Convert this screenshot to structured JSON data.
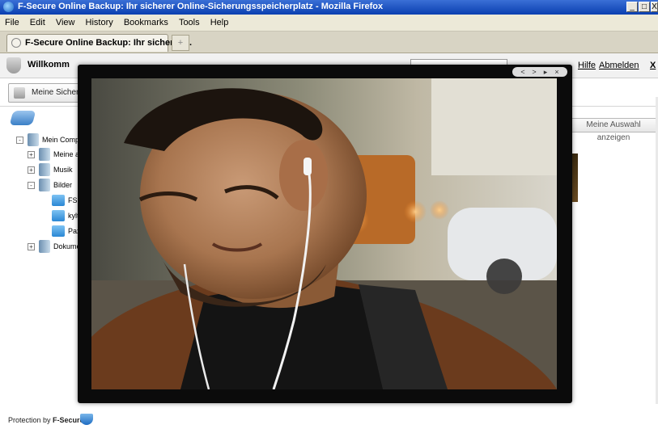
{
  "window": {
    "title": "F-Secure Online Backup: Ihr sicherer Online-Sicherungsspeicherplatz - Mozilla Firefox",
    "buttons": [
      "_",
      "□",
      "X"
    ]
  },
  "menu": [
    "File",
    "Edit",
    "View",
    "History",
    "Bookmarks",
    "Tools",
    "Help"
  ],
  "tabs": {
    "active": "F-Secure Online Backup: Ihr sicherer ...",
    "new_tab": "+"
  },
  "app_header": {
    "welcome": "Willkomm",
    "links": {
      "help": "Hilfe",
      "logout": "Abmelden",
      "close": "X"
    }
  },
  "toolbar": {
    "backup_tab": "Meine Sicheru",
    "show_selection": "Meine Auswahl anzeigen"
  },
  "tree": {
    "root": "Mein Compu",
    "items": [
      {
        "label": "Meine a"
      },
      {
        "label": "Musik"
      },
      {
        "label": "Bilder"
      },
      {
        "label": "FSk"
      },
      {
        "label": "kylt"
      },
      {
        "label": "Pax"
      },
      {
        "label": "Dokume"
      }
    ]
  },
  "viewer": {
    "controls": [
      "<",
      ">",
      "▸",
      "×"
    ]
  },
  "footer": {
    "protection": "Protection by ",
    "brand": "F-Secure"
  },
  "colors": {
    "titlebar": "#0a3fb0",
    "chrome": "#ece9d8",
    "overlay": "#0b0b0b"
  }
}
